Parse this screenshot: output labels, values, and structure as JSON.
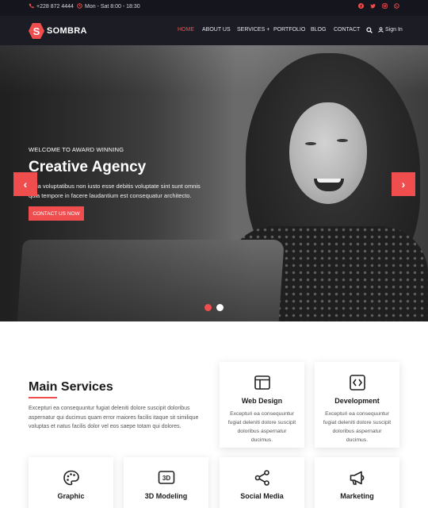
{
  "topbar": {
    "phone": "+228 872 4444",
    "hours": "Mon - Sat 8:00 - 18:30",
    "social": [
      "facebook-icon",
      "twitter-icon",
      "instagram-icon",
      "whatsapp-icon"
    ]
  },
  "nav": {
    "logo_text": "SOMBRA",
    "logo_letter": "S",
    "menu": [
      "HOME",
      "ABOUT US",
      "SERVICES +",
      "PORTFOLIO",
      "BLOG",
      "CONTACT"
    ],
    "sign_in": "Sign In"
  },
  "hero": {
    "kicker": "WELCOME TO AWARD WINNING",
    "title": "Creative Agency",
    "description": "Quia voluptatibus non iusto esse debitis voluptate sint sunt omnis quia tempore in facere laudantium est consequatur architecto.",
    "button": "CONTACT US NOW",
    "prev_arrow": "‹",
    "next_arrow": "›",
    "slides": 2,
    "active_slide": 1
  },
  "services": {
    "title": "Main Services",
    "description": "Excepturi ea consequuntur fugiat deleniti dolore suscipit doloribus aspernatur qui ducimus quam error maiores facilis itaque sit similique voluptas et natus facilis dolor vel eos saepe totam qui dolores.",
    "cards": [
      {
        "title": "Web Design",
        "desc": "Excepturi ea consequuntur fugiat deleniti dolore suscipit doloribus aspernatur ducimus.",
        "icon": "browser-window-icon"
      },
      {
        "title": "Development",
        "desc": "Excepturi ea consequuntur fugiat deleniti dolore suscipit doloribus aspernatur ducimus.",
        "icon": "code-icon"
      },
      {
        "title": "Graphic",
        "desc": "",
        "icon": "palette-icon"
      },
      {
        "title": "3D Modeling",
        "desc": "",
        "icon": "3d-icon"
      },
      {
        "title": "Social Media",
        "desc": "",
        "icon": "share-icon"
      },
      {
        "title": "Marketing",
        "desc": "",
        "icon": "megaphone-icon"
      }
    ]
  },
  "colors": {
    "accent": "#f04e4e",
    "topbar_bg": "#15151d",
    "nav_bg": "#1c1c25"
  }
}
